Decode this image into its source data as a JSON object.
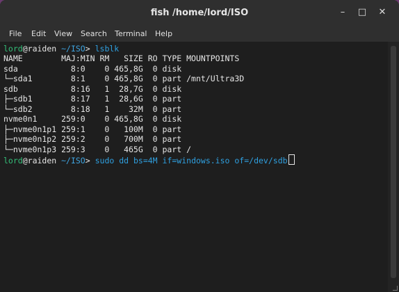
{
  "window": {
    "title": "fish /home/lord/ISO",
    "minimize_glyph": "–",
    "maximize_glyph": "□",
    "close_glyph": "✕"
  },
  "menu": [
    "File",
    "Edit",
    "View",
    "Search",
    "Terminal",
    "Help"
  ],
  "prompt": {
    "user": "lord",
    "at": "@",
    "host": "raiden",
    "path": " ~/ISO",
    "symbol": "> "
  },
  "commands": {
    "first": "lsblk",
    "second": "sudo dd bs=4M if=windows.iso of=/dev/sdb"
  },
  "output": [
    "NAME        MAJ:MIN RM   SIZE RO TYPE MOUNTPOINTS",
    "sda           8:0    0 465,8G  0 disk",
    "└─sda1        8:1    0 465,8G  0 part /mnt/Ultra3D",
    "sdb           8:16   1  28,7G  0 disk",
    "├─sdb1        8:17   1  28,6G  0 part",
    "└─sdb2        8:18   1    32M  0 part",
    "nvme0n1     259:0    0 465,8G  0 disk",
    "├─nvme0n1p1 259:1    0   100M  0 part",
    "├─nvme0n1p2 259:2    0   700M  0 part",
    "└─nvme0n1p3 259:3    0   465G  0 part /"
  ]
}
